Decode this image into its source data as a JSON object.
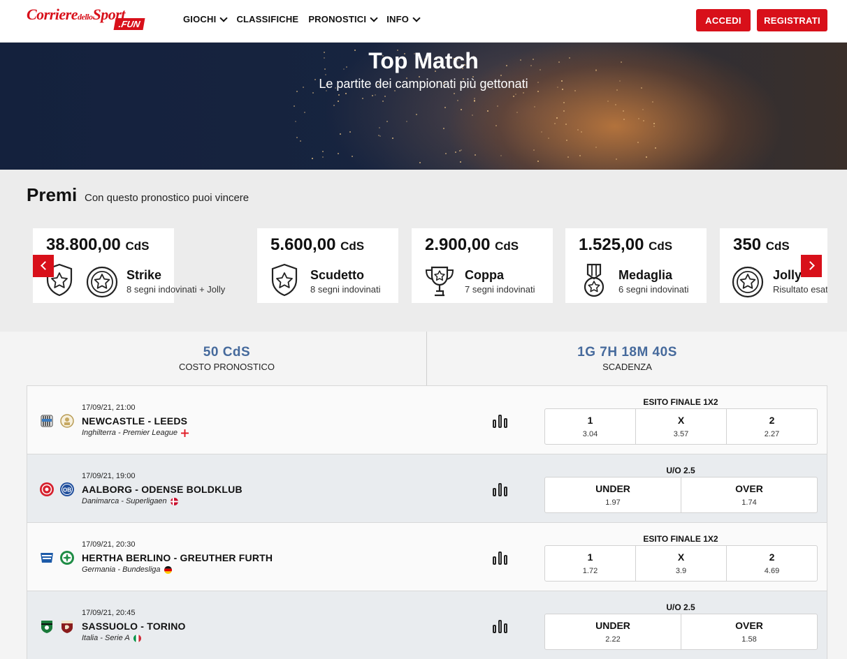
{
  "header": {
    "logo_text_main": "Corriere",
    "logo_text_small": "dello",
    "logo_text_sport": "Sport",
    "logo_text_fun": ".FUN",
    "nav": [
      {
        "label": "GIOCHI",
        "has_dropdown": true
      },
      {
        "label": "CLASSIFICHE",
        "has_dropdown": false
      },
      {
        "label": "PRONOSTICI",
        "has_dropdown": true
      },
      {
        "label": "INFO",
        "has_dropdown": true
      }
    ],
    "login_label": "ACCEDI",
    "register_label": "REGISTRATI"
  },
  "hero": {
    "title": "Top Match",
    "subtitle": "Le partite dei campionati più gettonati"
  },
  "premi": {
    "title": "Premi",
    "subtitle": "Con questo pronostico puoi vincere",
    "currency": "CdS",
    "cards": [
      {
        "amount": "38.800,00",
        "name": "Strike",
        "desc": "8 segni indovinati + Jolly",
        "icon": "shield-star-icon"
      },
      {
        "amount": "5.600,00",
        "name": "Scudetto",
        "desc": "8 segni indovinati",
        "icon": "shield-star-icon"
      },
      {
        "amount": "2.900,00",
        "name": "Coppa",
        "desc": "7 segni indovinati",
        "icon": "trophy-icon"
      },
      {
        "amount": "1.525,00",
        "name": "Medaglia",
        "desc": "6 segni indovinati",
        "icon": "medal-icon"
      },
      {
        "amount": "350",
        "name": "Jolly",
        "desc": "Risultato esatto",
        "icon": "star-circle-icon"
      }
    ]
  },
  "info": {
    "cost_value": "50 CdS",
    "cost_label": "COSTO PRONOSTICO",
    "deadline_value": "1G 7H 18M 40S",
    "deadline_label": "SCADENZA"
  },
  "matches": [
    {
      "date": "17/09/21, 21:00",
      "teams": "NEWCASTLE - LEEDS",
      "league": "Inghilterra - Premier League",
      "market": "ESITO FINALE 1X2",
      "odds": [
        {
          "sign": "1",
          "value": "3.04"
        },
        {
          "sign": "X",
          "value": "3.57"
        },
        {
          "sign": "2",
          "value": "2.27"
        }
      ]
    },
    {
      "date": "17/09/21, 19:00",
      "teams": "AALBORG - ODENSE BOLDKLUB",
      "league": "Danimarca - Superligaen",
      "market": "U/O 2.5",
      "odds": [
        {
          "sign": "UNDER",
          "value": "1.97"
        },
        {
          "sign": "OVER",
          "value": "1.74"
        }
      ]
    },
    {
      "date": "17/09/21, 20:30",
      "teams": "HERTHA BERLINO - GREUTHER FURTH",
      "league": "Germania - Bundesliga",
      "market": "ESITO FINALE 1X2",
      "odds": [
        {
          "sign": "1",
          "value": "1.72"
        },
        {
          "sign": "X",
          "value": "3.9"
        },
        {
          "sign": "2",
          "value": "4.69"
        }
      ]
    },
    {
      "date": "17/09/21, 20:45",
      "teams": "SASSUOLO - TORINO",
      "league": "Italia - Serie A",
      "market": "U/O 2.5",
      "odds": [
        {
          "sign": "UNDER",
          "value": "2.22"
        },
        {
          "sign": "OVER",
          "value": "1.58"
        }
      ]
    }
  ],
  "colors": {
    "brand_red": "#d8101a",
    "accent_blue": "#466a9c",
    "hero_dark": "#14213d"
  }
}
